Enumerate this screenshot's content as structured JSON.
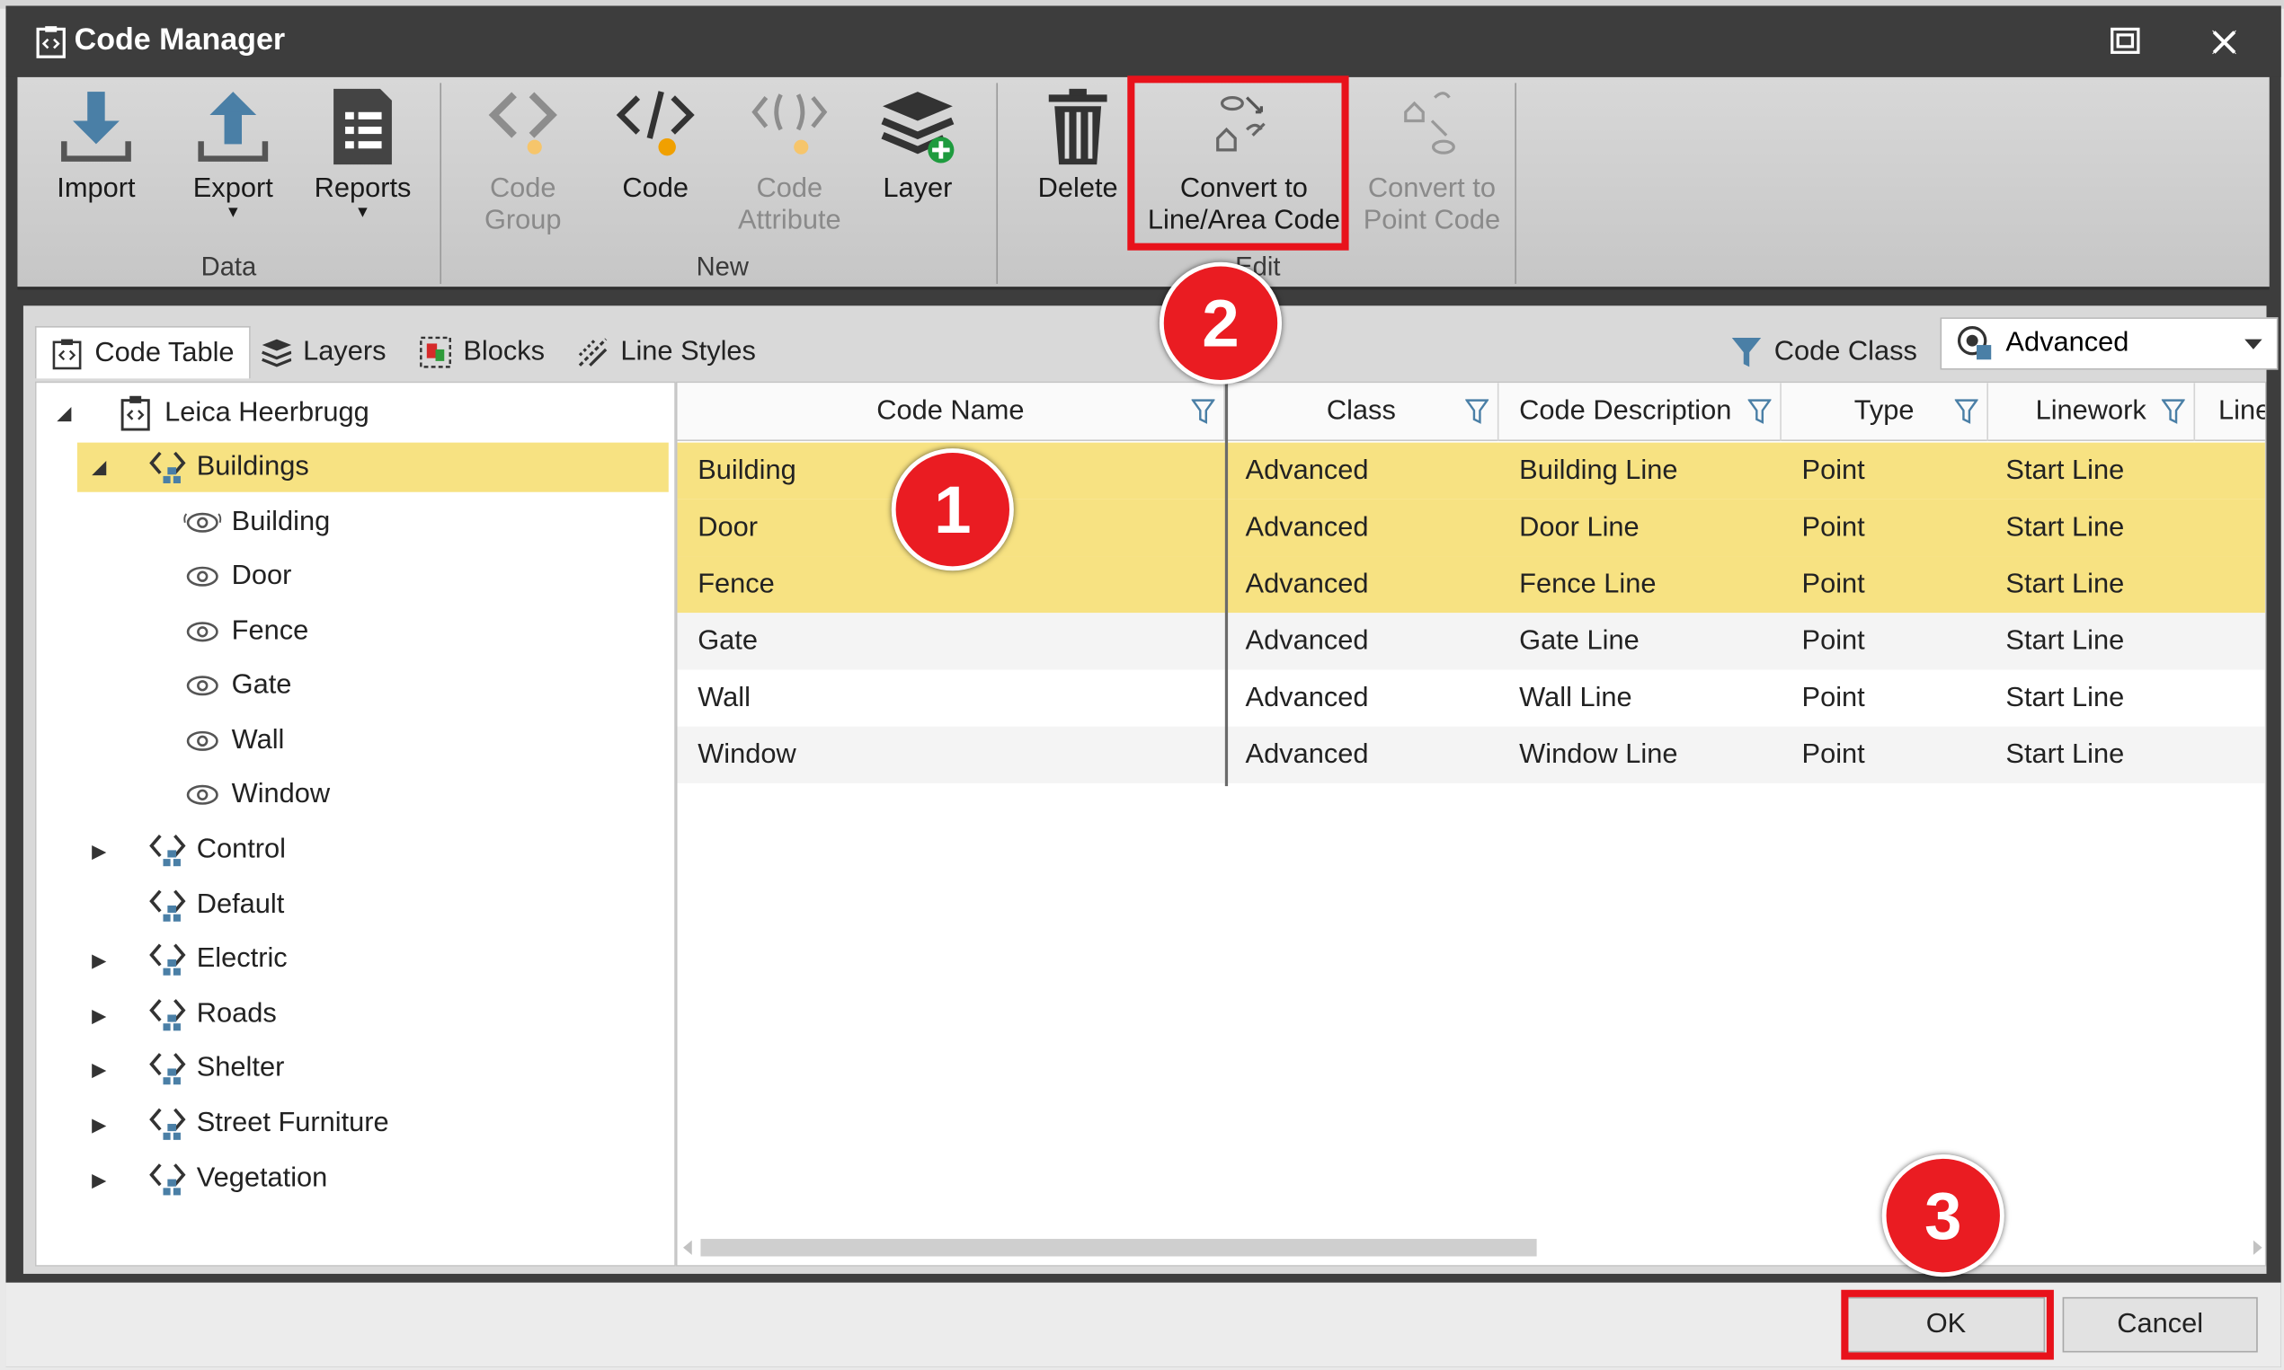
{
  "window": {
    "title": "Code Manager"
  },
  "ribbon": {
    "groups": [
      {
        "label": "Data",
        "buttons": [
          {
            "label": "Import",
            "disabled": false
          },
          {
            "label": "Export",
            "disabled": false,
            "dropdown": true
          },
          {
            "label": "Reports",
            "disabled": false,
            "dropdown": true
          }
        ]
      },
      {
        "label": "New",
        "buttons": [
          {
            "label_l1": "Code",
            "label_l2": "Group",
            "disabled": true
          },
          {
            "label": "Code",
            "disabled": false
          },
          {
            "label_l1": "Code",
            "label_l2": "Attribute",
            "disabled": true
          },
          {
            "label": "Layer",
            "disabled": false
          }
        ]
      },
      {
        "label": "Edit",
        "buttons": [
          {
            "label": "Delete",
            "disabled": false
          },
          {
            "label_l1": "Convert to",
            "label_l2": "Line/Area Code",
            "disabled": false
          },
          {
            "label_l1": "Convert to",
            "label_l2": "Point Code",
            "disabled": true
          }
        ]
      }
    ]
  },
  "tabs": [
    "Code Table",
    "Layers",
    "Blocks",
    "Line Styles"
  ],
  "code_class": {
    "label": "Code Class",
    "value": "Advanced"
  },
  "tree": {
    "root": "Leica Heerbrugg",
    "groups": [
      {
        "label": "Buildings",
        "expanded": true,
        "selected": true,
        "children": [
          "Building",
          "Door",
          "Fence",
          "Gate",
          "Wall",
          "Window"
        ]
      },
      {
        "label": "Control"
      },
      {
        "label": "Default"
      },
      {
        "label": "Electric"
      },
      {
        "label": "Roads"
      },
      {
        "label": "Shelter"
      },
      {
        "label": "Street Furniture"
      },
      {
        "label": "Vegetation"
      }
    ]
  },
  "grid": {
    "columns": [
      "Code Name",
      "Class",
      "Code Description",
      "Type",
      "Linework",
      "Line"
    ],
    "rows": [
      {
        "name": "Building",
        "class": "Advanced",
        "description": "Building Line",
        "type": "Point",
        "linework": "Start Line",
        "selected": true
      },
      {
        "name": "Door",
        "class": "Advanced",
        "description": "Door Line",
        "type": "Point",
        "linework": "Start Line",
        "selected": true
      },
      {
        "name": "Fence",
        "class": "Advanced",
        "description": "Fence Line",
        "type": "Point",
        "linework": "Start Line",
        "selected": true
      },
      {
        "name": "Gate",
        "class": "Advanced",
        "description": "Gate Line",
        "type": "Point",
        "linework": "Start Line",
        "selected": false
      },
      {
        "name": "Wall",
        "class": "Advanced",
        "description": "Wall Line",
        "type": "Point",
        "linework": "Start Line",
        "selected": false
      },
      {
        "name": "Window",
        "class": "Advanced",
        "description": "Window Line",
        "type": "Point",
        "linework": "Start Line",
        "selected": false
      }
    ]
  },
  "footer": {
    "ok_label": "OK",
    "cancel_label": "Cancel"
  },
  "markers": [
    "1",
    "2",
    "3"
  ],
  "colors": {
    "selection": "#f7e282",
    "highlight": "#e8121b",
    "marker": "#ea1c22",
    "titlebar": "#3d3d3d"
  }
}
